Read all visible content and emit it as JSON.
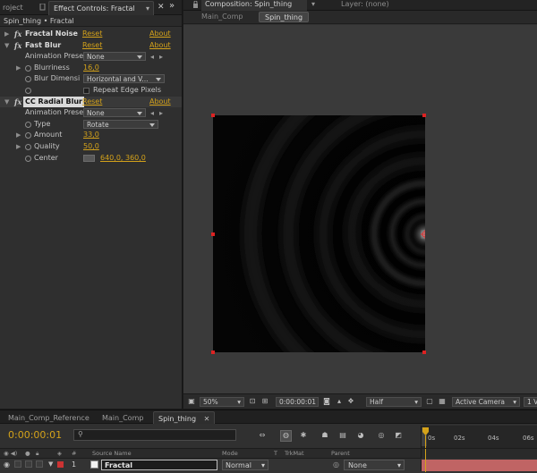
{
  "effect_controls": {
    "tabs": {
      "project": "roject",
      "effect_controls": "Effect Controls: Fractal"
    },
    "breadcrumb": "Spin_thing • Fractal",
    "effects": [
      {
        "name": "Fractal Noise",
        "reset": "Reset",
        "about": "About"
      },
      {
        "name": "Fast Blur",
        "reset": "Reset",
        "about": "About"
      },
      {
        "name": "CC Radial Blur",
        "reset": "Reset",
        "about": "About"
      }
    ],
    "fast_blur": {
      "animation_preset_label": "Animation Prese",
      "animation_preset_value": "None",
      "blurriness_label": "Blurriness",
      "blurriness_value": "16,0",
      "blur_dimensions_label": "Blur Dimensi",
      "blur_dimensions_value": "Horizontal and V...",
      "repeat_edge_label": "Repeat Edge Pixels"
    },
    "cc_radial_blur": {
      "animation_preset_label": "Animation Prese",
      "animation_preset_value": "None",
      "type_label": "Type",
      "type_value": "Rotate",
      "amount_label": "Amount",
      "amount_value": "33,0",
      "quality_label": "Quality",
      "quality_value": "50,0",
      "center_label": "Center",
      "center_value": "640,0, 360,0"
    },
    "fx_glyph": "fx"
  },
  "composition": {
    "tab_label": "Composition: Spin_thing",
    "layer_tab_label": "Layer: (none)",
    "subtabs": [
      "Main_Comp",
      "Spin_thing"
    ],
    "toolbar": {
      "zoom": "50%",
      "timecode": "0:00:00:01",
      "resolution": "Half",
      "camera": "Active Camera",
      "views": "1 V"
    }
  },
  "timeline": {
    "tabs": [
      "Main_Comp_Reference",
      "Main_Comp",
      "Spin_thing"
    ],
    "timecode": "0:00:00:01",
    "search_placeholder": "",
    "columns": {
      "hash": "#",
      "source_name": "Source Name",
      "mode": "Mode",
      "t": "T",
      "trkmat": "TrkMat",
      "parent": "Parent"
    },
    "ruler": [
      "0s",
      "02s",
      "04s",
      "06s"
    ],
    "layers": [
      {
        "number": "1",
        "name": "Fractal",
        "mode": "Normal",
        "parent": "None"
      }
    ]
  },
  "colors": {
    "accent": "#d4a21a",
    "handle": "#dd2222",
    "layer_bar": "#c06464"
  }
}
